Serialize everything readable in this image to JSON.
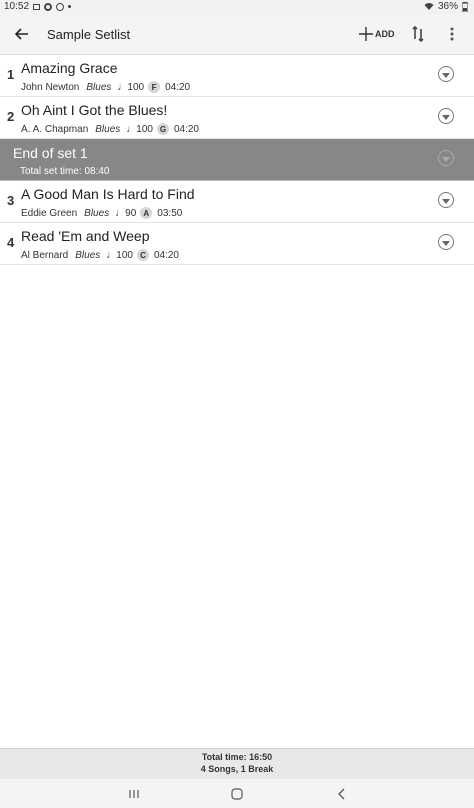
{
  "status_bar": {
    "time": "10:52",
    "battery": "36%"
  },
  "toolbar": {
    "title": "Sample Setlist",
    "add_label": "ADD"
  },
  "setlist": [
    {
      "number": "1",
      "title": "Amazing Grace",
      "artist": "John Newton",
      "genre": "Blues",
      "tempo": "100",
      "key": "F",
      "duration": "04:20"
    },
    {
      "number": "2",
      "title": "Oh Aint I Got the Blues!",
      "artist": "A. A. Chapman",
      "genre": "Blues",
      "tempo": "100",
      "key": "G",
      "duration": "04:20"
    }
  ],
  "break": {
    "title": "End of set 1",
    "subtitle": "Total set time: 08:40"
  },
  "setlist2": [
    {
      "number": "3",
      "title": "A Good Man Is Hard to Find",
      "artist": "Eddie Green",
      "genre": "Blues",
      "tempo": "90",
      "key": "A",
      "duration": "03:50"
    },
    {
      "number": "4",
      "title": "Read 'Em and Weep",
      "artist": "Al Bernard",
      "genre": "Blues",
      "tempo": "100",
      "key": "C",
      "duration": "04:20"
    }
  ],
  "summary": {
    "total_time": "Total time: 16:50",
    "counts": "4 Songs, 1 Break"
  },
  "colors": {
    "break_bg": "#878787",
    "key_badge": "#d6d6d6"
  }
}
